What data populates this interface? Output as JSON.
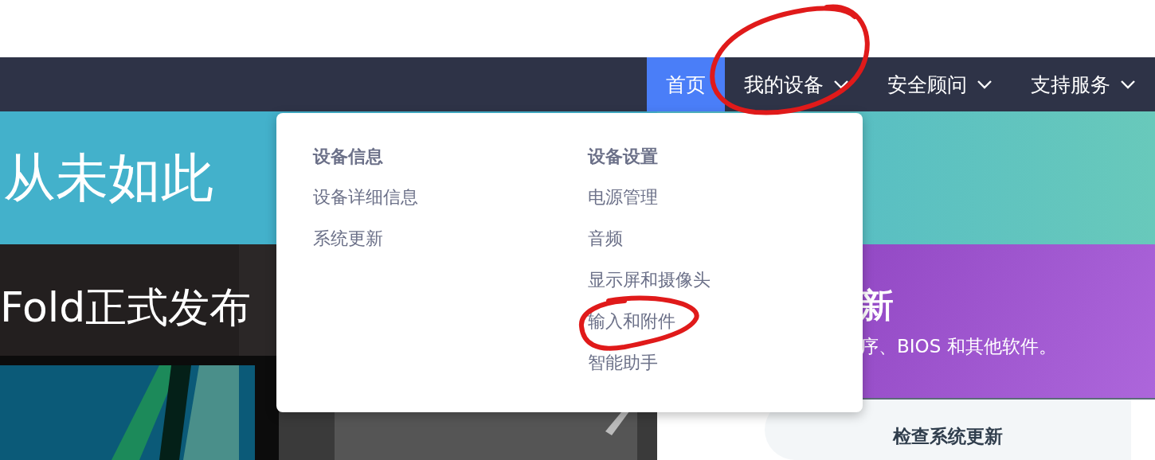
{
  "nav": {
    "items": [
      {
        "label": "首页",
        "selected": true,
        "has_menu": false
      },
      {
        "label": "我的设备",
        "selected": false,
        "has_menu": true
      },
      {
        "label": "安全顾问",
        "selected": false,
        "has_menu": true
      },
      {
        "label": "支持服务",
        "selected": false,
        "has_menu": true
      }
    ]
  },
  "dropdown": {
    "columns": [
      {
        "heading": "设备信息",
        "items": [
          "设备详细信息",
          "系统更新"
        ]
      },
      {
        "heading": "设备设置",
        "items": [
          "电源管理",
          "音频",
          "显示屏和摄像头",
          "输入和附件",
          "智能助手"
        ]
      }
    ]
  },
  "hero": {
    "banner_text": "从未如此",
    "slide_text": "Fold正式发布"
  },
  "update_card": {
    "title": "新",
    "subtitle": "序、BIOS 和其他软件。",
    "button": "检查系统更新"
  }
}
